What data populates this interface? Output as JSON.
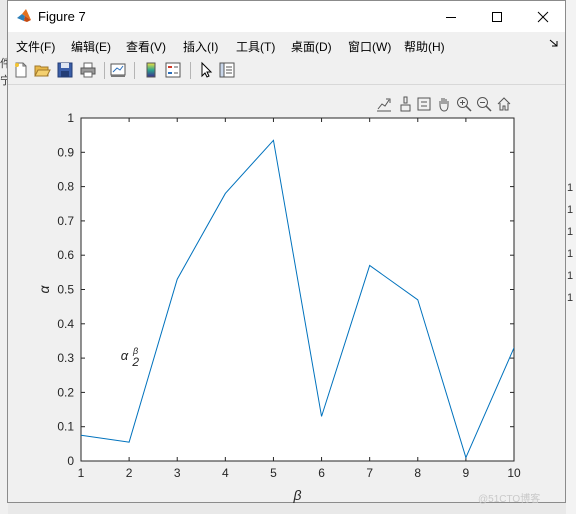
{
  "window": {
    "title": "Figure 7",
    "controls": [
      "minimize",
      "maximize",
      "close"
    ]
  },
  "menu": {
    "items": [
      {
        "label": "文件(F)"
      },
      {
        "label": "编辑(E)"
      },
      {
        "label": "查看(V)"
      },
      {
        "label": "插入(I)"
      },
      {
        "label": "工具(T)"
      },
      {
        "label": "桌面(D)"
      },
      {
        "label": "窗口(W)"
      },
      {
        "label": "帮助(H)"
      }
    ]
  },
  "toolbar": {
    "buttons": [
      "new-figure-icon",
      "open-file-icon",
      "save-icon",
      "print-icon",
      "link-plot-icon",
      "insert-colorbar-icon",
      "insert-legend-icon",
      "edit-plot-icon",
      "property-inspector-icon"
    ]
  },
  "axes_toolbar": {
    "buttons": [
      "export-icon",
      "brush-icon",
      "data-tips-icon",
      "pan-icon",
      "zoom-in-icon",
      "zoom-out-icon",
      "home-icon"
    ]
  },
  "background": {
    "right_digits": [
      "1",
      "1",
      "1",
      "1",
      "1",
      "1"
    ],
    "left_chars": [
      "件",
      "宁"
    ]
  },
  "watermark": "@51CTO博客",
  "chart_data": {
    "type": "line",
    "x": [
      1,
      2,
      3,
      4,
      5,
      6,
      7,
      8,
      9,
      10
    ],
    "series": [
      {
        "values": [
          0.075,
          0.055,
          0.53,
          0.78,
          0.935,
          0.13,
          0.57,
          0.47,
          0.01,
          0.33
        ],
        "color": "#0072bd"
      }
    ],
    "xlabel": "β",
    "ylabel": "α",
    "xlim": [
      1,
      10
    ],
    "ylim": [
      0,
      1
    ],
    "xticks": [
      "1",
      "2",
      "3",
      "4",
      "5",
      "6",
      "7",
      "8",
      "9",
      "10"
    ],
    "yticks": [
      "0",
      "0.1",
      "0.2",
      "0.3",
      "0.4",
      "0.5",
      "0.6",
      "0.7",
      "0.8",
      "0.9",
      "1"
    ],
    "grid": false,
    "annotation": {
      "base": "α",
      "sup": "β",
      "sub": "2",
      "x": 2,
      "y": 0.3
    }
  }
}
